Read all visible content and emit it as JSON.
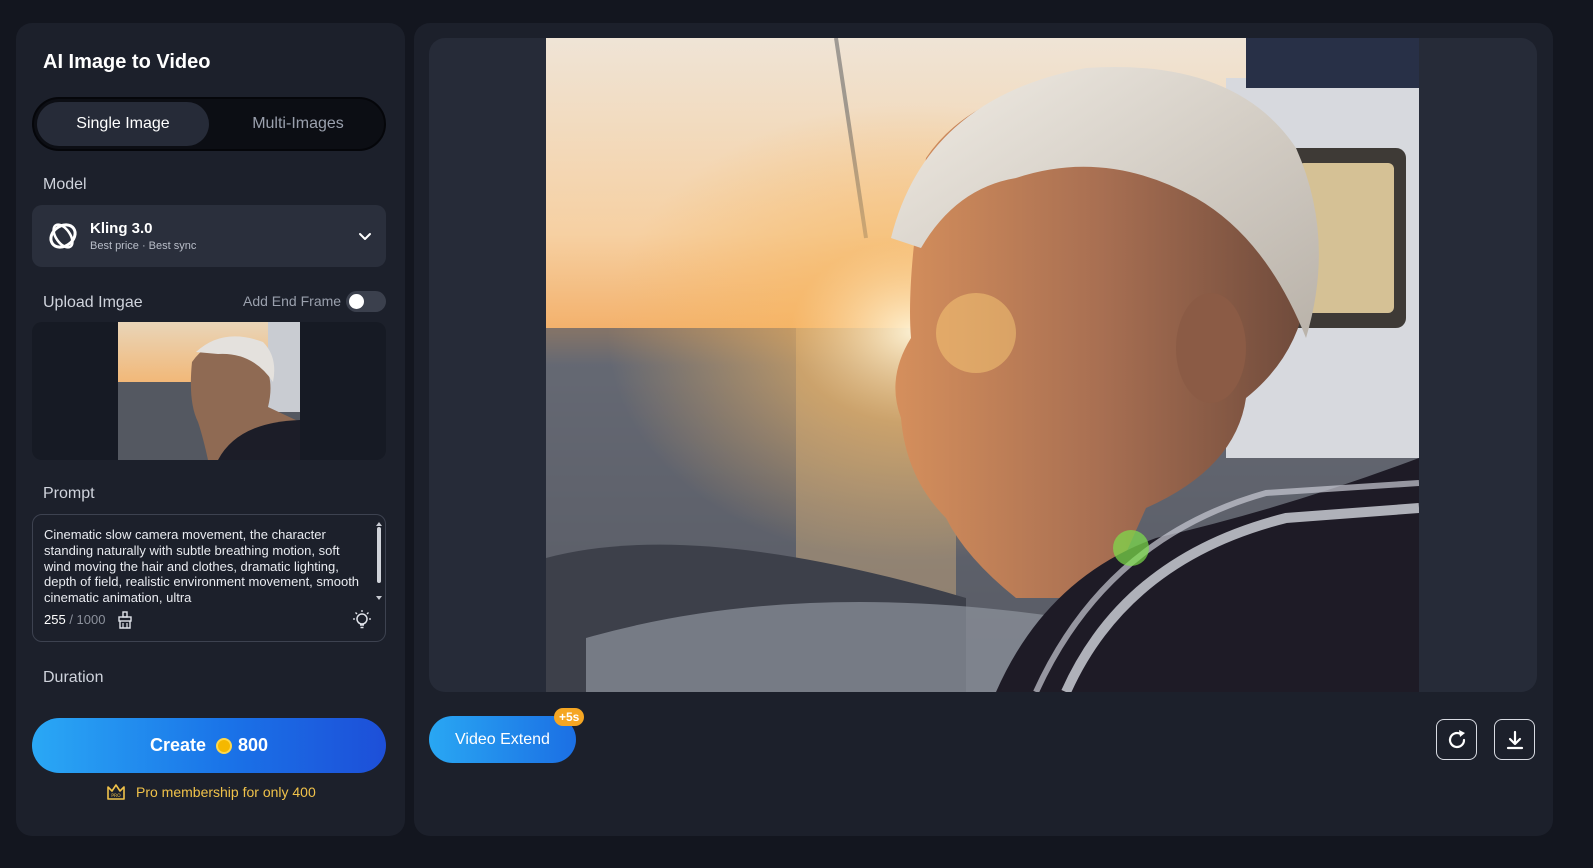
{
  "left_panel": {
    "title": "AI Image to Video",
    "tabs": [
      {
        "label": "Single Image",
        "active": true
      },
      {
        "label": "Multi-Images",
        "active": false
      }
    ],
    "model_label": "Model",
    "model": {
      "name": "Kling 3.0",
      "subtitle": "Best price · Best sync"
    },
    "upload_label": "Upload Imgae",
    "end_frame_label": "Add End Frame",
    "end_frame_enabled": false,
    "prompt_label": "Prompt",
    "prompt_text": "Cinematic slow camera movement, the character standing naturally with subtle breathing motion, soft wind moving the hair and clothes, dramatic lighting, depth of field, realistic environment movement, smooth cinematic animation, ultra",
    "char_count": "255",
    "char_max": "/ 1000",
    "duration_label": "Duration",
    "create_label": "Create",
    "create_cost": "800",
    "pro_text": "Pro membership for only 400"
  },
  "right_panel": {
    "extend_label": "Video Extend",
    "extend_badge": "+5s"
  },
  "colors": {
    "background": "#13161f",
    "panel": "#1c202b",
    "accent_blue": "#1a73e8",
    "coin": "#f5b800",
    "pro": "#f0c24a"
  },
  "icons": [
    "kling-logo-icon",
    "chevron-down-icon",
    "clear-icon",
    "bulb-icon",
    "coin-icon",
    "pro-crown-icon",
    "refresh-icon",
    "download-icon"
  ]
}
